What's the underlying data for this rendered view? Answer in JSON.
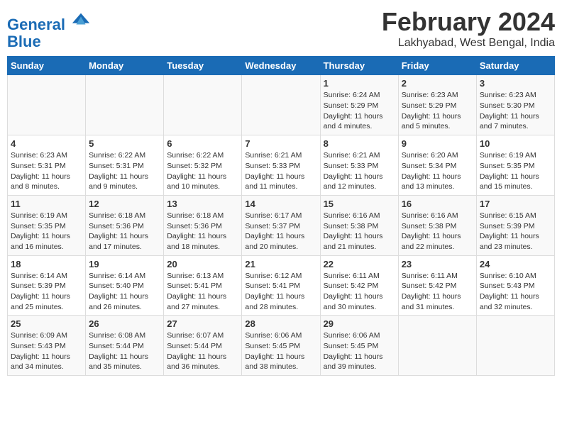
{
  "logo": {
    "line1": "General",
    "line2": "Blue"
  },
  "title": "February 2024",
  "subtitle": "Lakhyabad, West Bengal, India",
  "days_of_week": [
    "Sunday",
    "Monday",
    "Tuesday",
    "Wednesday",
    "Thursday",
    "Friday",
    "Saturday"
  ],
  "weeks": [
    [
      {
        "num": "",
        "info": ""
      },
      {
        "num": "",
        "info": ""
      },
      {
        "num": "",
        "info": ""
      },
      {
        "num": "",
        "info": ""
      },
      {
        "num": "1",
        "info": "Sunrise: 6:24 AM\nSunset: 5:29 PM\nDaylight: 11 hours\nand 4 minutes."
      },
      {
        "num": "2",
        "info": "Sunrise: 6:23 AM\nSunset: 5:29 PM\nDaylight: 11 hours\nand 5 minutes."
      },
      {
        "num": "3",
        "info": "Sunrise: 6:23 AM\nSunset: 5:30 PM\nDaylight: 11 hours\nand 7 minutes."
      }
    ],
    [
      {
        "num": "4",
        "info": "Sunrise: 6:23 AM\nSunset: 5:31 PM\nDaylight: 11 hours\nand 8 minutes."
      },
      {
        "num": "5",
        "info": "Sunrise: 6:22 AM\nSunset: 5:31 PM\nDaylight: 11 hours\nand 9 minutes."
      },
      {
        "num": "6",
        "info": "Sunrise: 6:22 AM\nSunset: 5:32 PM\nDaylight: 11 hours\nand 10 minutes."
      },
      {
        "num": "7",
        "info": "Sunrise: 6:21 AM\nSunset: 5:33 PM\nDaylight: 11 hours\nand 11 minutes."
      },
      {
        "num": "8",
        "info": "Sunrise: 6:21 AM\nSunset: 5:33 PM\nDaylight: 11 hours\nand 12 minutes."
      },
      {
        "num": "9",
        "info": "Sunrise: 6:20 AM\nSunset: 5:34 PM\nDaylight: 11 hours\nand 13 minutes."
      },
      {
        "num": "10",
        "info": "Sunrise: 6:19 AM\nSunset: 5:35 PM\nDaylight: 11 hours\nand 15 minutes."
      }
    ],
    [
      {
        "num": "11",
        "info": "Sunrise: 6:19 AM\nSunset: 5:35 PM\nDaylight: 11 hours\nand 16 minutes."
      },
      {
        "num": "12",
        "info": "Sunrise: 6:18 AM\nSunset: 5:36 PM\nDaylight: 11 hours\nand 17 minutes."
      },
      {
        "num": "13",
        "info": "Sunrise: 6:18 AM\nSunset: 5:36 PM\nDaylight: 11 hours\nand 18 minutes."
      },
      {
        "num": "14",
        "info": "Sunrise: 6:17 AM\nSunset: 5:37 PM\nDaylight: 11 hours\nand 20 minutes."
      },
      {
        "num": "15",
        "info": "Sunrise: 6:16 AM\nSunset: 5:38 PM\nDaylight: 11 hours\nand 21 minutes."
      },
      {
        "num": "16",
        "info": "Sunrise: 6:16 AM\nSunset: 5:38 PM\nDaylight: 11 hours\nand 22 minutes."
      },
      {
        "num": "17",
        "info": "Sunrise: 6:15 AM\nSunset: 5:39 PM\nDaylight: 11 hours\nand 23 minutes."
      }
    ],
    [
      {
        "num": "18",
        "info": "Sunrise: 6:14 AM\nSunset: 5:39 PM\nDaylight: 11 hours\nand 25 minutes."
      },
      {
        "num": "19",
        "info": "Sunrise: 6:14 AM\nSunset: 5:40 PM\nDaylight: 11 hours\nand 26 minutes."
      },
      {
        "num": "20",
        "info": "Sunrise: 6:13 AM\nSunset: 5:41 PM\nDaylight: 11 hours\nand 27 minutes."
      },
      {
        "num": "21",
        "info": "Sunrise: 6:12 AM\nSunset: 5:41 PM\nDaylight: 11 hours\nand 28 minutes."
      },
      {
        "num": "22",
        "info": "Sunrise: 6:11 AM\nSunset: 5:42 PM\nDaylight: 11 hours\nand 30 minutes."
      },
      {
        "num": "23",
        "info": "Sunrise: 6:11 AM\nSunset: 5:42 PM\nDaylight: 11 hours\nand 31 minutes."
      },
      {
        "num": "24",
        "info": "Sunrise: 6:10 AM\nSunset: 5:43 PM\nDaylight: 11 hours\nand 32 minutes."
      }
    ],
    [
      {
        "num": "25",
        "info": "Sunrise: 6:09 AM\nSunset: 5:43 PM\nDaylight: 11 hours\nand 34 minutes."
      },
      {
        "num": "26",
        "info": "Sunrise: 6:08 AM\nSunset: 5:44 PM\nDaylight: 11 hours\nand 35 minutes."
      },
      {
        "num": "27",
        "info": "Sunrise: 6:07 AM\nSunset: 5:44 PM\nDaylight: 11 hours\nand 36 minutes."
      },
      {
        "num": "28",
        "info": "Sunrise: 6:06 AM\nSunset: 5:45 PM\nDaylight: 11 hours\nand 38 minutes."
      },
      {
        "num": "29",
        "info": "Sunrise: 6:06 AM\nSunset: 5:45 PM\nDaylight: 11 hours\nand 39 minutes."
      },
      {
        "num": "",
        "info": ""
      },
      {
        "num": "",
        "info": ""
      }
    ]
  ]
}
